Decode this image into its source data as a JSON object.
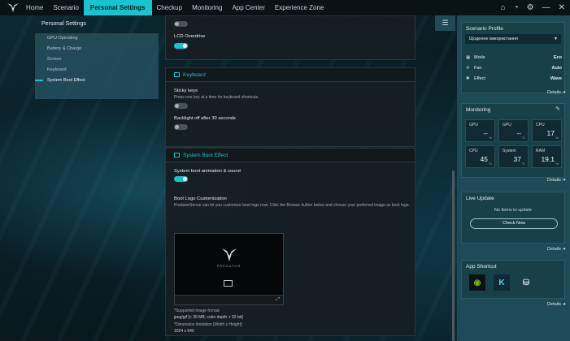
{
  "nav": {
    "items": [
      "Home",
      "Scenario",
      "Personal Settings",
      "Checkup",
      "Monitoring",
      "App Center",
      "Experience Zone"
    ],
    "active_index": 2,
    "accent": "#16c5d1"
  },
  "left": {
    "title": "Personal Settings",
    "menu": [
      "GPU Operating",
      "Battery & Charge",
      "Screen",
      "Keyboard",
      "System Boot Effect"
    ],
    "active_index": 4
  },
  "center": {
    "lcd_overdrive_label": "LCD Overdrive",
    "keyboard_title": "Keyboard",
    "sticky_keys_label": "Sticky keys",
    "sticky_keys_desc": "Press one key at a time for keyboard shortcuts.",
    "backlight_label": "Backlight off after 30 seconds",
    "boot_title": "System Boot Effect",
    "boot_anim_label": "System boot animation & sound",
    "logo_custom_title": "Boot Logo Customization",
    "logo_custom_desc": "PredatorSense can let you customize boot logo now. Click the Browse button below and choose your preferred image as boot logo.",
    "brand_text": "PREDATOR",
    "format_title": "*Supported image format:",
    "format_value": "jpeg/gif [< 35 MB, color depth > 32-bit]",
    "dimension_title": "*Dimension limitation [Width x Height]:",
    "dimension_value": "1024 x 640"
  },
  "right": {
    "scenario": {
      "title": "Scenario Profile",
      "selected": "Щоденне використання",
      "rows": [
        {
          "label": "Mode",
          "value": "Eco"
        },
        {
          "label": "Fan",
          "value": "Auto"
        },
        {
          "label": "Effect",
          "value": "Wave"
        }
      ],
      "details": "Details"
    },
    "monitoring": {
      "title": "Monitoring",
      "tiles": [
        {
          "label": "GPU",
          "value": "--",
          "unit": "%"
        },
        {
          "label": "GPU",
          "value": "--",
          "unit": "°C"
        },
        {
          "label": "CPU",
          "value": "17",
          "unit": "%"
        },
        {
          "label": "CPU",
          "value": "45",
          "unit": "°C"
        },
        {
          "label": "System",
          "value": "37",
          "unit": "°C"
        },
        {
          "label": "RAM",
          "value": "19.1",
          "unit": "%"
        }
      ],
      "details": "Details"
    },
    "live_update": {
      "title": "Live Update",
      "message": "No items to update",
      "button": "Check Now",
      "details": "Details"
    },
    "shortcut": {
      "title": "App Shortcut",
      "apps": [
        "nvidia-icon",
        "k-app-icon",
        "disk-icon"
      ],
      "details": "Details"
    }
  }
}
